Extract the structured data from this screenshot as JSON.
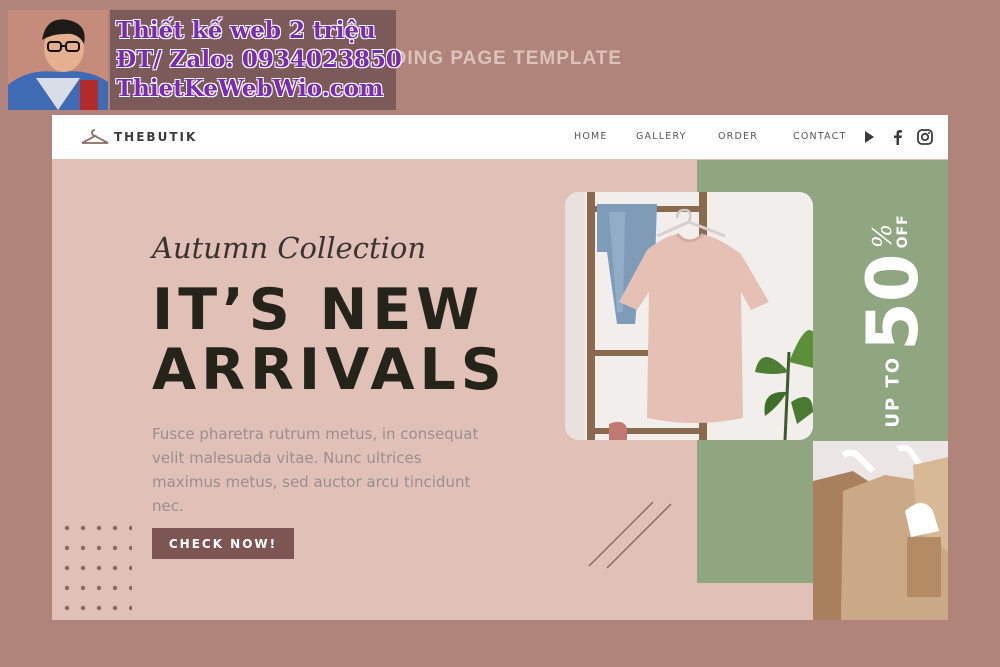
{
  "watermark": {
    "heading": "NDING PAGE TEMPLATE",
    "lines": [
      "Thiết kế web 2 triệu",
      "ĐT/ Zalo: 0934023850",
      "ThietKeWebWio.com"
    ]
  },
  "brand": {
    "name": "THEBUTIK"
  },
  "nav": {
    "links": [
      "HOME",
      "GALLERY",
      "ORDER",
      "CONTACT"
    ],
    "social_icons": [
      "youtube-play-icon",
      "facebook-icon",
      "instagram-icon"
    ]
  },
  "hero": {
    "subtitle": "Autumn Collection",
    "headline_line1": "IT’S NEW",
    "headline_line2": "ARRIVALS",
    "body": "Fusce pharetra rutrum metus, in consequat velit malesuada vitae. Nunc ultrices maximus metus, sed auctor arcu tincidunt nec.",
    "cta": "CHECK NOW!"
  },
  "sale": {
    "prefix": "UP TO",
    "amount": "50",
    "percent": "%",
    "suffix": "OFF"
  },
  "colors": {
    "background": "#b0847a",
    "card": "#e0c0b7",
    "accent_green": "#8fa681",
    "button": "#7d5654",
    "headline": "#25241a"
  }
}
